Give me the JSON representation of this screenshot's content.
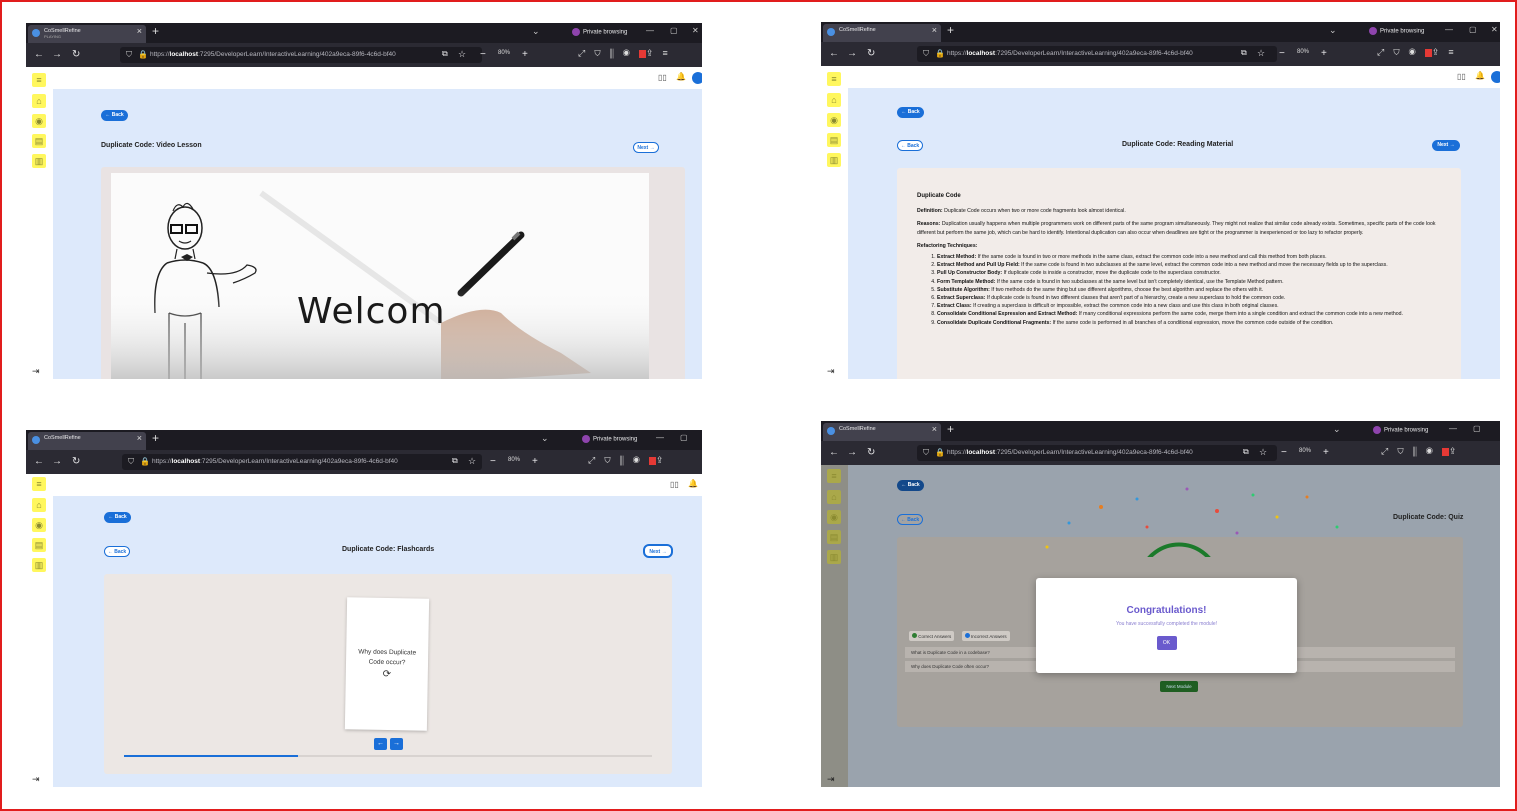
{
  "browser": {
    "tab_title": "CoSmellRefine",
    "tab_status": "PLAYING",
    "private_label": "Private browsing",
    "url_prefix": "https://",
    "url_host": "localhost",
    "url_rest": ":7295/DeveloperLearn/InteractiveLearning/402a9eca-89f6-4c6d-bf40",
    "zoom": "80%"
  },
  "common": {
    "back_label": "← Back",
    "next_label": "Next →"
  },
  "video": {
    "title": "Duplicate Code: Video Lesson",
    "whiteboard_text": "Welcom"
  },
  "reading": {
    "title": "Duplicate Code: Reading Material",
    "heading": "Duplicate Code",
    "definition_label": "Definition:",
    "definition": "Duplicate Code occurs when two or more code fragments look almost identical.",
    "reasons_label": "Reasons:",
    "reasons": "Duplication usually happens when multiple programmers work on different parts of the same program simultaneously. They might not realize that similar code already exists. Sometimes, specific parts of the code look different but perform the same job, which can be hard to identify. Intentional duplication can also occur when deadlines are tight or the programmer is inexperienced or too lazy to refactor properly.",
    "techniques_heading": "Refactoring Techniques:",
    "techniques": [
      {
        "name": "Extract Method:",
        "text": "If the same code is found in two or more methods in the same class, extract the common code into a new method and call this method from both places."
      },
      {
        "name": "Extract Method and Pull Up Field:",
        "text": "If the same code is found in two subclasses at the same level, extract the common code into a new method and move the necessary fields up to the superclass."
      },
      {
        "name": "Pull Up Constructor Body:",
        "text": "If duplicate code is inside a constructor, move the duplicate code to the superclass constructor."
      },
      {
        "name": "Form Template Method:",
        "text": "If the same code is found in two subclasses at the same level but isn't completely identical, use the Template Method pattern."
      },
      {
        "name": "Substitute Algorithm:",
        "text": "If two methods do the same thing but use different algorithms, choose the best algorithm and replace the others with it."
      },
      {
        "name": "Extract Superclass:",
        "text": "If duplicate code is found in two different classes that aren't part of a hierarchy, create a new superclass to hold the common code."
      },
      {
        "name": "Extract Class:",
        "text": "If creating a superclass is difficult or impossible, extract the common code into a new class and use this class in both original classes."
      },
      {
        "name": "Consolidate Conditional Expression and Extract Method:",
        "text": "If many conditional expressions perform the same code, merge them into a single condition and extract the common code into a new method."
      },
      {
        "name": "Consolidate Duplicate Conditional Fragments:",
        "text": "If the same code is performed in all branches of a conditional expression, move the common code outside of the condition."
      }
    ]
  },
  "flashcards": {
    "title": "Duplicate Code: Flashcards",
    "card_question": "Why does Duplicate Code occur?",
    "progress": 0.33
  },
  "quiz": {
    "title": "Duplicate Code: Quiz",
    "modal_title": "Congratulations!",
    "modal_message": "You have successfully completed the module!",
    "ok_label": "OK",
    "legend_correct": "Correct Answers",
    "legend_incorrect": "Incorrect Answers",
    "questions": [
      "What is Duplicate Code in a codebase?",
      "Why does Duplicate Code often occur?"
    ],
    "next_module_label": "Next Module"
  },
  "colors": {
    "accent": "#1a6fd8",
    "frame_border": "#e11d1d",
    "sidebar_icon_bg": "#fff75e",
    "content_bg": "#dde9fb",
    "modal_title": "#6a5acd",
    "next_module_bg": "#2e7d32"
  },
  "icons": [
    "menu-icon",
    "home-icon",
    "eye-icon",
    "book-icon",
    "document-icon",
    "logout-icon",
    "bell-icon",
    "sync-icon"
  ]
}
